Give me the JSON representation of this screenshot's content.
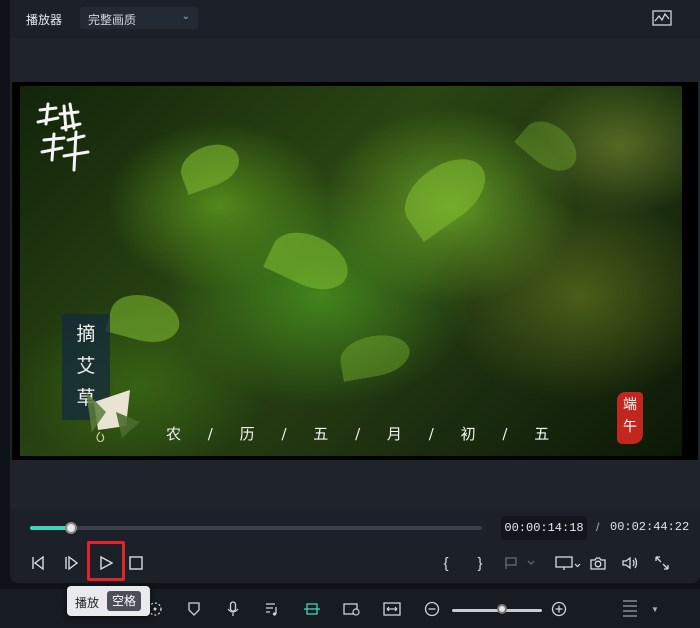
{
  "header": {
    "player_label": "播放器",
    "quality": "完整画质"
  },
  "video": {
    "title_vertical": [
      "摘",
      "艾",
      "草"
    ],
    "date_text": [
      "农",
      "/",
      "历",
      "/",
      "五",
      "/",
      "月",
      "/",
      "初",
      "/",
      "五"
    ],
    "seal_text": [
      "端",
      "午"
    ],
    "colors": {
      "seal": "#c1271f",
      "foliage": "#4a8a1f"
    }
  },
  "playback": {
    "current_time": "00:00:14:18",
    "separator": "/",
    "total_time": "00:02:44:22",
    "progress_fraction": 0.0907
  },
  "tooltip": {
    "label": "播放",
    "shortcut": "空格"
  },
  "zoom": {
    "level_fraction": 0.55
  },
  "accent_color": "#3fd6b7",
  "highlight_color": "#e0242a"
}
